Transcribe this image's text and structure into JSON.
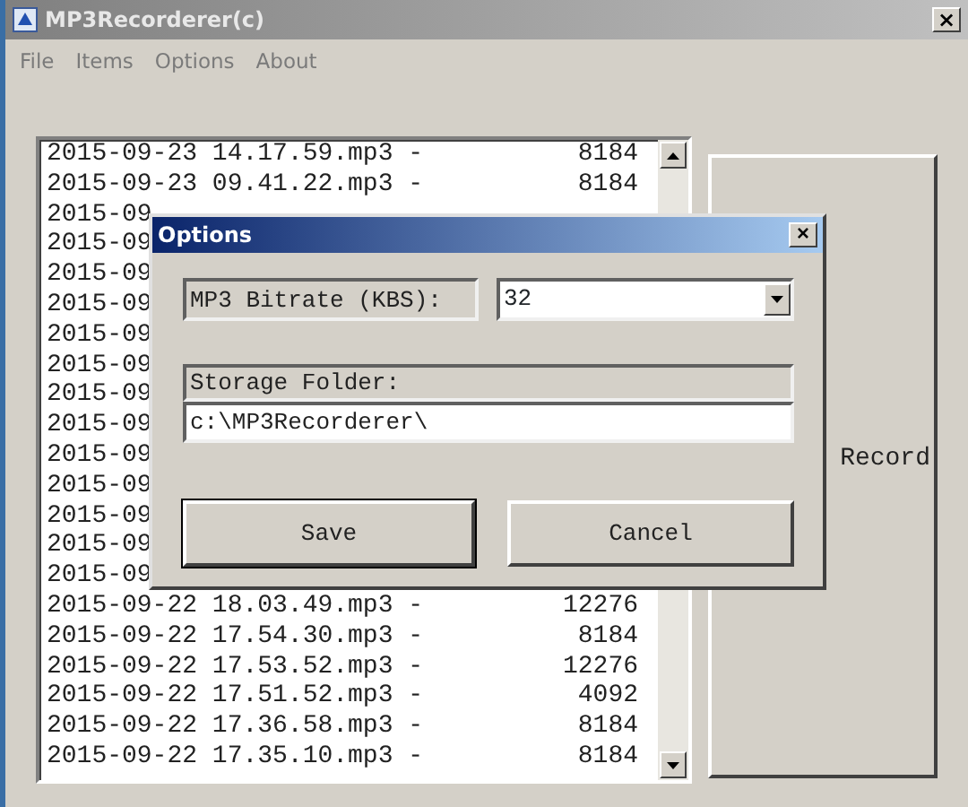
{
  "window": {
    "title": "MP3Recorderer(c)",
    "close": "×"
  },
  "menu": [
    "File",
    "Items",
    "Options",
    "About"
  ],
  "recordings": [
    {
      "name": "2015-09-23 14.17.59.mp3 -",
      "size": "8184"
    },
    {
      "name": "2015-09-23 09.41.22.mp3 -",
      "size": "8184"
    },
    {
      "name": "2015-09"
    },
    {
      "name": "2015-09"
    },
    {
      "name": "2015-09"
    },
    {
      "name": "2015-09"
    },
    {
      "name": "2015-09"
    },
    {
      "name": "2015-09"
    },
    {
      "name": "2015-09"
    },
    {
      "name": "2015-09"
    },
    {
      "name": "2015-09"
    },
    {
      "name": "2015-09"
    },
    {
      "name": "2015-09"
    },
    {
      "name": "2015-09"
    },
    {
      "name": "2015-09"
    },
    {
      "name": "2015-09-22 18.03.49.mp3 -",
      "size": "12276"
    },
    {
      "name": "2015-09-22 17.54.30.mp3 -",
      "size": "8184"
    },
    {
      "name": "2015-09-22 17.53.52.mp3 -",
      "size": "12276"
    },
    {
      "name": "2015-09-22 17.51.52.mp3 -",
      "size": "4092"
    },
    {
      "name": "2015-09-22 17.36.58.mp3 -",
      "size": "8184"
    },
    {
      "name": "2015-09-22 17.35.10.mp3 -",
      "size": "8184"
    }
  ],
  "record_button": "Record",
  "dialog": {
    "title": "Options",
    "close": "×",
    "bitrate_label": "MP3 Bitrate (KBS):",
    "bitrate_value": "32",
    "folder_label": "Storage Folder:",
    "folder_value": "c:\\MP3Recorderer\\",
    "buttons": [
      "Save",
      "Cancel"
    ]
  }
}
